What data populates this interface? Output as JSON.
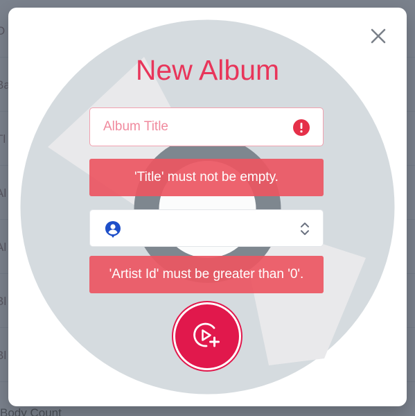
{
  "background": {
    "row_fragments": [
      "O",
      "Ba",
      "Tl",
      "Al",
      "Al",
      "Bl",
      "Bl"
    ],
    "footer_fragment": "Body Count"
  },
  "modal": {
    "title": "New Album",
    "close_icon": "close-icon",
    "album_title": {
      "value": "",
      "placeholder": "Album Title",
      "status_icon": "error-circle-icon"
    },
    "title_error": "'Title' must not be empty.",
    "artist": {
      "value": "",
      "leading_icon": "person-pin-icon",
      "trailing_icon": "chevron-up-down-icon"
    },
    "artist_error": "'Artist Id' must be greater than '0'.",
    "submit_icon": "play-circle-add-icon"
  },
  "colors": {
    "accent": "#e8355a",
    "button": "#e1184c",
    "error_bg": "#ec5662",
    "icon_blue": "#1e4fc9"
  }
}
